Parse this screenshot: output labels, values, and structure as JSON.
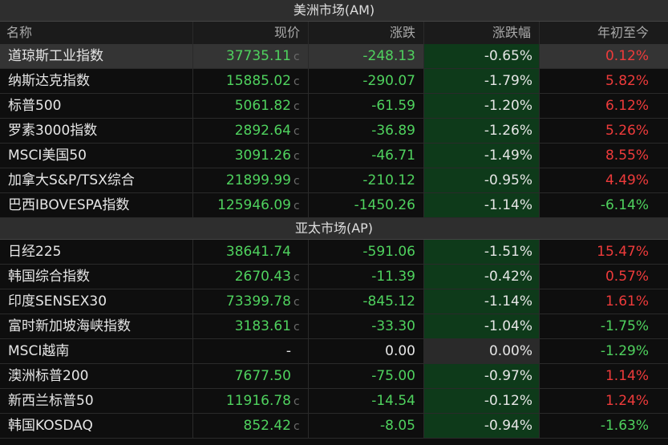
{
  "colors": {
    "green": "#4fd25e",
    "red": "#ef3b3b",
    "neg_bg": "#0e3a1a"
  },
  "columns": [
    "名称",
    "现价",
    "涨跌",
    "涨跌幅",
    "年初至今"
  ],
  "sections": [
    {
      "title": "美洲市场(AM)",
      "rows": [
        {
          "name": "道琼斯工业指数",
          "price": "37735.11",
          "suffix": "c",
          "change": "-248.13",
          "pct": "-0.65%",
          "ytd": "0.12%"
        },
        {
          "name": "纳斯达克指数",
          "price": "15885.02",
          "suffix": "c",
          "change": "-290.07",
          "pct": "-1.79%",
          "ytd": "5.82%"
        },
        {
          "name": "标普500",
          "price": "5061.82",
          "suffix": "c",
          "change": "-61.59",
          "pct": "-1.20%",
          "ytd": "6.12%"
        },
        {
          "name": "罗素3000指数",
          "price": "2892.64",
          "suffix": "c",
          "change": "-36.89",
          "pct": "-1.26%",
          "ytd": "5.26%"
        },
        {
          "name": "MSCI美国50",
          "price": "3091.26",
          "suffix": "c",
          "change": "-46.71",
          "pct": "-1.49%",
          "ytd": "8.55%"
        },
        {
          "name": "加拿大S&P/TSX综合",
          "price": "21899.99",
          "suffix": "c",
          "change": "-210.12",
          "pct": "-0.95%",
          "ytd": "4.49%"
        },
        {
          "name": "巴西IBOVESPA指数",
          "price": "125946.09",
          "suffix": "c",
          "change": "-1450.26",
          "pct": "-1.14%",
          "ytd": "-6.14%"
        }
      ]
    },
    {
      "title": "亚太市场(AP)",
      "rows": [
        {
          "name": "日经225",
          "price": "38641.74",
          "suffix": "",
          "change": "-591.06",
          "pct": "-1.51%",
          "ytd": "15.47%"
        },
        {
          "name": "韩国综合指数",
          "price": "2670.43",
          "suffix": "c",
          "change": "-11.39",
          "pct": "-0.42%",
          "ytd": "0.57%"
        },
        {
          "name": "印度SENSEX30",
          "price": "73399.78",
          "suffix": "c",
          "change": "-845.12",
          "pct": "-1.14%",
          "ytd": "1.61%"
        },
        {
          "name": "富时新加坡海峡指数",
          "price": "3183.61",
          "suffix": "c",
          "change": "-33.30",
          "pct": "-1.04%",
          "ytd": "-1.75%"
        },
        {
          "name": "MSCI越南",
          "price": "-",
          "suffix": "",
          "change": "0.00",
          "pct": "0.00%",
          "ytd": "-1.29%"
        },
        {
          "name": "澳洲标普200",
          "price": "7677.50",
          "suffix": "",
          "change": "-75.00",
          "pct": "-0.97%",
          "ytd": "1.14%"
        },
        {
          "name": "新西兰标普50",
          "price": "11916.78",
          "suffix": "c",
          "change": "-14.54",
          "pct": "-0.12%",
          "ytd": "1.24%"
        },
        {
          "name": "韩国KOSDAQ",
          "price": "852.42",
          "suffix": "c",
          "change": "-8.05",
          "pct": "-0.94%",
          "ytd": "-1.63%"
        }
      ]
    }
  ]
}
